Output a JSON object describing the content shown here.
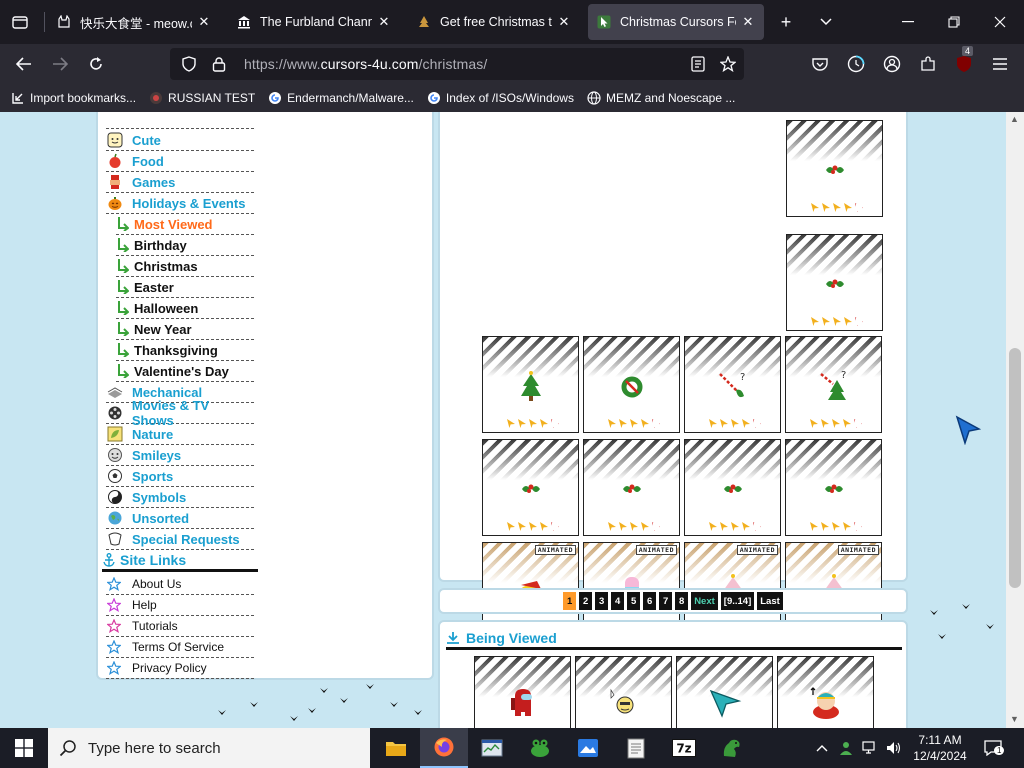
{
  "browser": {
    "tabs": [
      {
        "title": "快乐大食堂 - meow.car",
        "favicon": "cat-icon",
        "active": false
      },
      {
        "title": "The Furbland Channel",
        "favicon": "bank-icon",
        "active": false
      },
      {
        "title": "Get free Christmas tree",
        "favicon": "tree-icon",
        "active": false
      },
      {
        "title": "Christmas Cursors For",
        "favicon": "cursor-favicon",
        "active": true
      }
    ],
    "url": {
      "prefix": "https://www.",
      "host": "cursors-4u.com",
      "path": "/christmas/"
    },
    "bookmarks": [
      {
        "label": "Import bookmarks...",
        "icon": "import-icon"
      },
      {
        "label": "RUSSIAN TEST",
        "icon": "globe-icon"
      },
      {
        "label": "Endermanch/Malware...",
        "icon": "google-icon"
      },
      {
        "label": "Index of /ISOs/Windows",
        "icon": "google-icon"
      },
      {
        "label": "MEMZ and Noescape ...",
        "icon": "globe-icon"
      }
    ],
    "extension_badge": "4"
  },
  "page": {
    "categories_top": [
      {
        "label": "Cute",
        "icon": "face-icon"
      },
      {
        "label": "Food",
        "icon": "apple-icon"
      },
      {
        "label": "Games",
        "icon": "game-icon"
      },
      {
        "label": "Holidays & Events",
        "icon": "pumpkin-icon"
      }
    ],
    "subcategories": [
      {
        "label": "Most Viewed",
        "current": true
      },
      {
        "label": "Birthday",
        "current": false
      },
      {
        "label": "Christmas",
        "current": false
      },
      {
        "label": "Easter",
        "current": false
      },
      {
        "label": "Halloween",
        "current": false
      },
      {
        "label": "New Year",
        "current": false
      },
      {
        "label": "Thanksgiving",
        "current": false
      },
      {
        "label": "Valentine's Day",
        "current": false
      }
    ],
    "categories_bottom": [
      {
        "label": "Mechanical",
        "icon": "gear-icon"
      },
      {
        "label": "Movies & TV Shows",
        "icon": "film-icon"
      },
      {
        "label": "Nature",
        "icon": "leaf-icon"
      },
      {
        "label": "Smileys",
        "icon": "smiley-icon"
      },
      {
        "label": "Sports",
        "icon": "ball-icon"
      },
      {
        "label": "Symbols",
        "icon": "yinyang-icon"
      },
      {
        "label": "Unsorted",
        "icon": "globe-icon"
      },
      {
        "label": "Special Requests",
        "icon": "request-icon"
      }
    ],
    "site_links_title": "Site Links",
    "site_links": [
      "About Us",
      "Help",
      "Tutorials",
      "Terms Of Service",
      "Privacy Policy"
    ],
    "cursor_cards": [
      {
        "art": "holly-icon",
        "animated": false
      },
      {
        "art": "holly-icon",
        "animated": false
      },
      {
        "art": "tree-icon",
        "animated": false
      },
      {
        "art": "wreath-icon",
        "animated": false
      },
      {
        "art": "candy-cane-icon",
        "animated": false
      },
      {
        "art": "candy-cane-tree-icon",
        "animated": false
      },
      {
        "art": "holly-icon",
        "animated": false
      },
      {
        "art": "holly-icon",
        "animated": false
      },
      {
        "art": "holly-icon",
        "animated": false
      },
      {
        "art": "holly-icon",
        "animated": false
      },
      {
        "art": "psyduck-santa-icon",
        "animated": true
      },
      {
        "art": "popsicle-icon",
        "animated": true
      },
      {
        "art": "pink-tree-icon",
        "animated": true
      },
      {
        "art": "pink-tree-icon",
        "animated": true
      }
    ],
    "animated_badge": "ANIMATED",
    "pagination": {
      "pages": [
        "1",
        "2",
        "3",
        "4",
        "5",
        "6",
        "7",
        "8"
      ],
      "current": "1",
      "next": "Next",
      "range": "[9..14]",
      "last": "Last"
    },
    "being_viewed_title": "Being Viewed",
    "being_viewed": [
      {
        "art": "among-us-icon"
      },
      {
        "art": "emoji-cursor-icon"
      },
      {
        "art": "teal-arrow-icon"
      },
      {
        "art": "cartman-icon"
      }
    ]
  },
  "taskbar": {
    "search_placeholder": "Type here to search",
    "time": "7:11 AM",
    "date": "12/4/2024"
  },
  "colors": {
    "category_link": "#1a9fd0",
    "current_sub": "#ff6a1a",
    "page_bg": "#c8e6f2",
    "browser_chrome": "#2b2a33"
  }
}
